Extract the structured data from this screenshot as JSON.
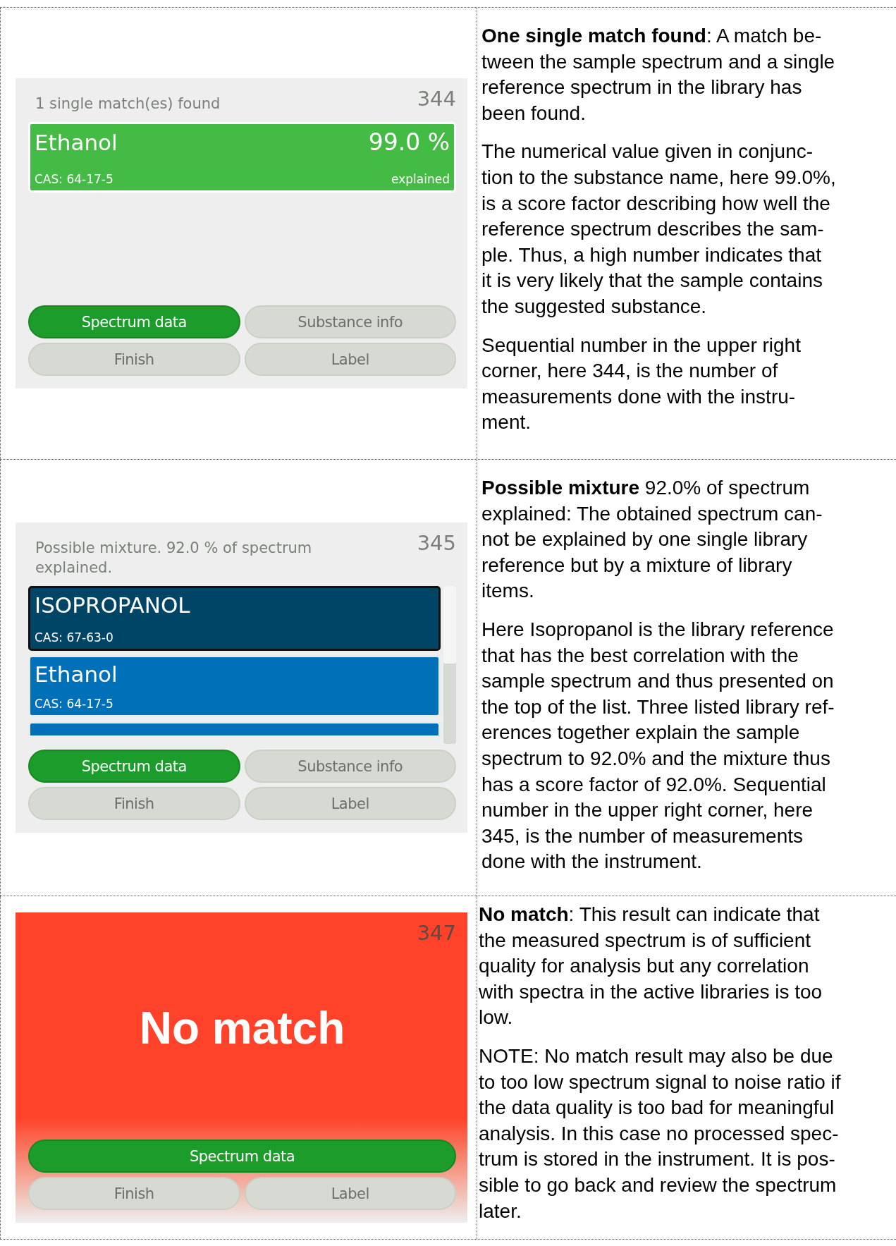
{
  "rows": [
    {
      "screen": {
        "kind": "result",
        "message": "1 single match(es) found",
        "number": "344",
        "scrollable": false,
        "matches": [
          {
            "kind": "match",
            "name": "Ethanol",
            "cas": "CAS: 64-17-5",
            "score": "99.0 %",
            "score_label": "explained",
            "color": "#44bb44",
            "selected": false
          }
        ],
        "buttons": [
          {
            "label": "Spectrum data",
            "primary": true
          },
          {
            "label": "Substance info",
            "primary": false
          },
          {
            "label": "Finish",
            "primary": false
          },
          {
            "label": "Label",
            "primary": false
          }
        ]
      },
      "description": [
        [
          "**One single match found**: A match be-",
          "tween the sample spectrum and a single",
          "reference spectrum in the library has",
          "been found."
        ],
        [
          "The numerical value given in conjunc-",
          "tion to the substance name, here 99.0%,",
          "is a score factor describing how well the",
          "reference spectrum describes the sam-",
          "ple. Thus, a high number indicates that",
          "it is very likely that the sample contains",
          "the suggested substance."
        ],
        [
          "Sequential number in the upper right",
          "corner, here 344, is the number of",
          "measurements done with the instru-",
          "ment."
        ]
      ]
    },
    {
      "screen": {
        "kind": "result",
        "message": "Possible mixture. 92.0 % of spectrum explained.",
        "number": "345",
        "scrollable": true,
        "matches": [
          {
            "kind": "match",
            "name": "ISOPROPANOL",
            "cas": "CAS: 67-63-0",
            "color": "#004466",
            "selected": true
          },
          {
            "kind": "match",
            "name": "Ethanol",
            "cas": "CAS: 64-17-5",
            "color": "#0070b8",
            "selected": false
          },
          {
            "kind": "stub",
            "color": "#0070b8",
            "selected": false
          }
        ],
        "buttons": [
          {
            "label": "Spectrum data",
            "primary": true
          },
          {
            "label": "Substance info",
            "primary": false
          },
          {
            "label": "Finish",
            "primary": false
          },
          {
            "label": "Label",
            "primary": false
          }
        ]
      },
      "description": [
        [
          "**Possible mixture** 92.0% of spectrum",
          "explained: The obtained spectrum can-",
          "not be explained by one single library",
          "reference but by a mixture of library",
          "items."
        ],
        [
          "Here Isopropanol is the library reference",
          "that has the best correlation with the",
          "sample spectrum and thus presented on",
          "the top of the list. Three listed library ref-",
          "erences together explain the sample",
          "spectrum to 92.0% and the mixture thus",
          "has a score factor of 92.0%. Sequential",
          "number in the upper right corner, here",
          "345, is the number of measurements",
          "done with the instrument."
        ]
      ]
    },
    {
      "screen": {
        "kind": "no_match",
        "title": "No match",
        "number": "347",
        "buttons": [
          {
            "label": "Spectrum data",
            "primary": true
          },
          {
            "label": "Finish",
            "primary": false
          },
          {
            "label": "Label",
            "primary": false
          }
        ]
      },
      "description": [
        [
          "**No match**: This result can indicate that",
          "the measured spectrum is of sufficient",
          "quality for analysis but any correlation",
          "with spectra in the active libraries is too",
          "low."
        ],
        [
          "NOTE: No match result may also be due",
          "to too low spectrum signal to noise ratio if",
          "the data quality is too bad for meaningful",
          "analysis. In this case no processed spec-",
          "trum is stored in the instrument. It is pos-",
          "sible to go back and review the spectrum",
          "later."
        ]
      ]
    }
  ]
}
